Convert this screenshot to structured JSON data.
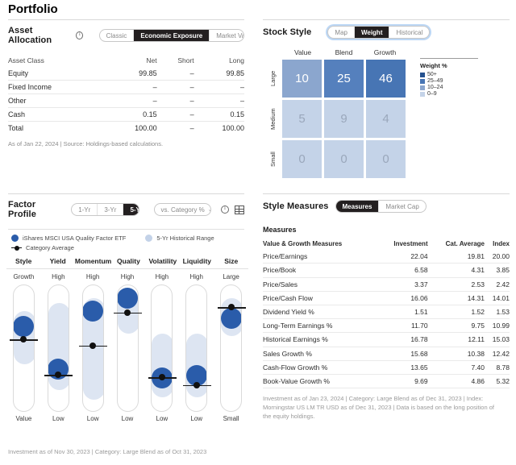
{
  "page": {
    "title": "Portfolio"
  },
  "asset_allocation": {
    "title": "Asset Allocation",
    "info_icon": "info-icon",
    "tabs": [
      {
        "label": "Classic",
        "active": false
      },
      {
        "label": "Economic Exposure",
        "active": true
      },
      {
        "label": "Market Value",
        "active": false
      }
    ],
    "columns": [
      "Asset Class",
      "Net",
      "Short",
      "Long"
    ],
    "rows": [
      {
        "cells": [
          "Equity",
          "99.85",
          "–",
          "99.85"
        ]
      },
      {
        "cells": [
          "Fixed Income",
          "–",
          "–",
          "–"
        ]
      },
      {
        "cells": [
          "Other",
          "–",
          "–",
          "–"
        ]
      },
      {
        "cells": [
          "Cash",
          "0.15",
          "–",
          "0.15"
        ]
      },
      {
        "cells": [
          "Total",
          "100.00",
          "–",
          "100.00"
        ]
      }
    ],
    "footnote": "As of Jan 22, 2024 | Source: Holdings-based calculations."
  },
  "stock_style": {
    "title": "Stock Style",
    "tabs": [
      {
        "label": "Map",
        "active": false
      },
      {
        "label": "Weight",
        "active": true
      },
      {
        "label": "Historical",
        "active": false
      }
    ],
    "chart_data": {
      "type": "heatmap",
      "title": "Stock Style — Weight",
      "columns": [
        "Value",
        "Blend",
        "Growth"
      ],
      "rows": [
        "Large",
        "Medium",
        "Small"
      ],
      "values": [
        [
          10,
          25,
          46
        ],
        [
          5,
          9,
          4
        ],
        [
          0,
          0,
          0
        ]
      ],
      "cell_colors": [
        [
          "#8ba6ce",
          "#5580bd",
          "#4775b4"
        ],
        [
          "#c4d3e8",
          "#c4d3e8",
          "#c4d3e8"
        ],
        [
          "#c4d3e8",
          "#c4d3e8",
          "#c4d3e8"
        ]
      ],
      "legend_title": "Weight %",
      "legend": [
        {
          "label": "50+",
          "color": "#25518f"
        },
        {
          "label": "25–49",
          "color": "#4775b4"
        },
        {
          "label": "10–24",
          "color": "#8ba6ce"
        },
        {
          "label": "0–9",
          "color": "#c4d3e8"
        }
      ],
      "legend_position": "right"
    }
  },
  "factor_profile": {
    "title": "Factor Profile",
    "period_tabs": [
      {
        "label": "1-Yr",
        "active": false
      },
      {
        "label": "3-Yr",
        "active": false
      },
      {
        "label": "5-Yr",
        "active": true
      }
    ],
    "compare_select": {
      "label": "vs. Category %",
      "caret": "chevron-down-icon"
    },
    "info_icon": "info-icon",
    "table_icon": "table-view-icon",
    "legend": [
      {
        "label": "iShares MSCI USA Quality Factor ETF",
        "marker": "solid-blue-dot",
        "color": "#2a5caa"
      },
      {
        "label": "5-Yr Historical Range",
        "marker": "light-blue-dot",
        "color": "#c3d2e8"
      },
      {
        "label": "Category Average",
        "marker": "line-dot",
        "color": "#111111"
      }
    ],
    "chart_data": {
      "type": "scatter",
      "title": "Factor Profile vs. Category %",
      "ylim": [
        0,
        100
      ],
      "grid": false,
      "factors": [
        {
          "name": "Style",
          "top_label": "Growth",
          "bottom_label": "Value",
          "value": 68,
          "category_average": 57,
          "range_low": 38,
          "range_high": 80
        },
        {
          "name": "Yield",
          "top_label": "High",
          "bottom_label": "Low",
          "value": 34,
          "category_average": 29,
          "range_low": 18,
          "range_high": 86
        },
        {
          "name": "Momentum",
          "top_label": "High",
          "bottom_label": "Low",
          "value": 80,
          "category_average": 52,
          "range_low": 10,
          "range_high": 90
        },
        {
          "name": "Quality",
          "top_label": "High",
          "bottom_label": "Low",
          "value": 90,
          "category_average": 78,
          "range_low": 62,
          "range_high": 97
        },
        {
          "name": "Volatility",
          "top_label": "High",
          "bottom_label": "Low",
          "value": 27,
          "category_average": 27,
          "range_low": 12,
          "range_high": 62
        },
        {
          "name": "Liquidity",
          "top_label": "High",
          "bottom_label": "Low",
          "value": 29,
          "category_average": 21,
          "range_low": 12,
          "range_high": 62
        },
        {
          "name": "Size",
          "top_label": "Large",
          "bottom_label": "Small",
          "value": 74,
          "category_average": 82,
          "range_low": 60,
          "range_high": 90
        }
      ]
    },
    "footnote": "Investment as of Nov 30, 2023 | Category: Large Blend as of Oct 31, 2023"
  },
  "style_measures": {
    "title": "Style Measures",
    "tabs": [
      {
        "label": "Measures",
        "active": true
      },
      {
        "label": "Market Cap",
        "active": false
      }
    ],
    "subtitle": "Measures",
    "columns": [
      "Value & Growth Measures",
      "Investment",
      "Cat. Average",
      "Index"
    ],
    "rows": [
      {
        "cells": [
          "Price/Earnings",
          "22.04",
          "19.81",
          "20.00"
        ]
      },
      {
        "cells": [
          "Price/Book",
          "6.58",
          "4.31",
          "3.85"
        ]
      },
      {
        "cells": [
          "Price/Sales",
          "3.37",
          "2.53",
          "2.42"
        ]
      },
      {
        "cells": [
          "Price/Cash Flow",
          "16.06",
          "14.31",
          "14.01"
        ]
      },
      {
        "cells": [
          "Dividend Yield %",
          "1.51",
          "1.52",
          "1.53"
        ]
      },
      {
        "cells": [
          "Long-Term Earnings %",
          "11.70",
          "9.75",
          "10.99"
        ]
      },
      {
        "cells": [
          "Historical Earnings %",
          "16.78",
          "12.11",
          "15.03"
        ]
      },
      {
        "cells": [
          "Sales Growth %",
          "15.68",
          "10.38",
          "12.42"
        ]
      },
      {
        "cells": [
          "Cash-Flow Growth %",
          "13.65",
          "7.40",
          "8.78"
        ]
      },
      {
        "cells": [
          "Book-Value Growth %",
          "9.69",
          "4.86",
          "5.32"
        ]
      }
    ],
    "footnote": "Investment as of Jan 23, 2024 | Category: Large Blend as of Dec 31, 2023 | Index: Morningstar US LM TR USD as of Dec 31, 2023 | Data is based on the long position of the equity holdings."
  }
}
